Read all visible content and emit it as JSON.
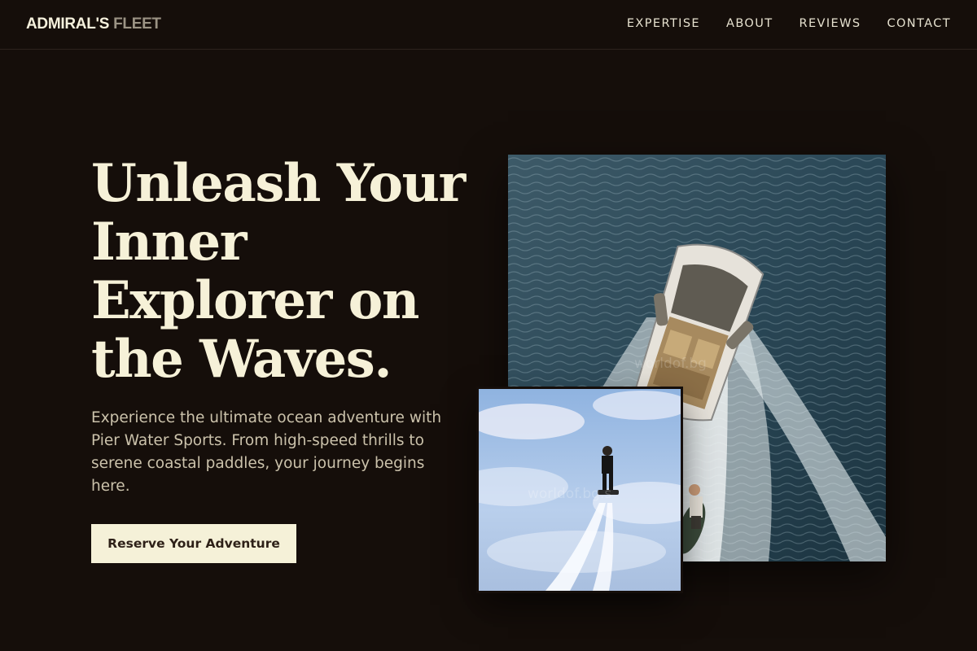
{
  "nav": {
    "brand_primary": "ADMIRAL'S",
    "brand_secondary": "FLEET",
    "links": [
      "EXPERTISE",
      "ABOUT",
      "REVIEWS",
      "CONTACT"
    ]
  },
  "hero": {
    "title": "Unleash Your Inner Explorer on the Waves.",
    "subtitle": "Experience the ultimate ocean adventure with Pier Water Sports. From high-speed thrills to serene coastal paddles, your journey begins here.",
    "cta_label": "Reserve Your Adventure"
  },
  "images": {
    "main_watermark": "worldof.bg",
    "small_watermark": "worldof.bg.s"
  },
  "colors": {
    "background": "#150e0a",
    "heading": "#f6f1d8",
    "body_text": "#cbc2ab",
    "cta_bg": "#f5f1d8",
    "cta_text": "#2e2118"
  }
}
